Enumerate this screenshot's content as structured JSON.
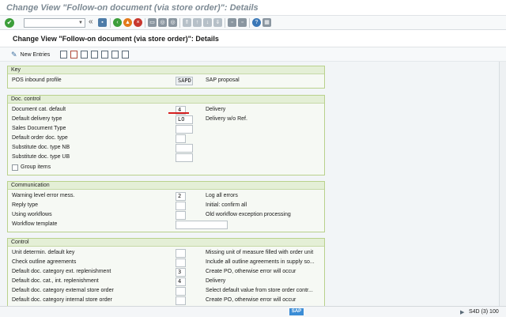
{
  "window": {
    "title": "Change View \"Follow-on document (via store order)\": Details"
  },
  "system_toolbar": {
    "ok_icon": "check-icon",
    "command_field": {
      "value": "",
      "placeholder": ""
    },
    "collapse_glyph": "«",
    "colors": {
      "green": "#3c9e3a",
      "orange": "#e37a1b",
      "red": "#c8382f",
      "blue": "#3b78b7",
      "gray": "#8a96a0"
    }
  },
  "header": {
    "title": "Change View \"Follow-on document (via store order)\": Details"
  },
  "app_toolbar": {
    "new_entries_label": "New Entries"
  },
  "groups": {
    "key": {
      "title": "Key",
      "rows": [
        {
          "label": "POS inbound profile",
          "value": "SAPD",
          "desc": "SAP proposal"
        }
      ]
    },
    "doc_control": {
      "title": "Doc. control",
      "rows": [
        {
          "label": "Document cat. default",
          "value": "4",
          "desc": "Delivery"
        },
        {
          "label": "Default delivery type",
          "value": "LO",
          "desc": "Delivery w/o Ref."
        },
        {
          "label": "Sales Document Type",
          "value": "",
          "desc": ""
        },
        {
          "label": "Default order doc. type",
          "value": "",
          "desc": ""
        },
        {
          "label": "Substitute doc. type NB",
          "value": "",
          "desc": ""
        },
        {
          "label": "Substitute doc. type UB",
          "value": "",
          "desc": ""
        }
      ],
      "checkbox": {
        "label": "Group items",
        "checked": false
      }
    },
    "communication": {
      "title": "Communication",
      "rows": [
        {
          "label": "Warning level error mess.",
          "value": "2",
          "desc": "Log all errors"
        },
        {
          "label": "Reply type",
          "value": "",
          "desc": "Initial: confirm all"
        },
        {
          "label": "Using workflows",
          "value": "",
          "desc": "Old workflow exception processing"
        },
        {
          "label": "Workflow template",
          "value": "",
          "desc": ""
        }
      ]
    },
    "control": {
      "title": "Control",
      "rows": [
        {
          "label": "Unit determin. default key",
          "value": "",
          "desc": "Missing unit of measure filled with order unit"
        },
        {
          "label": "Check outline agreements",
          "value": "",
          "desc": "Include all outline agreements in supply so..."
        },
        {
          "label": "Default doc. category ext. replenishment",
          "value": "3",
          "desc": "Create PO, otherwise error will occur"
        },
        {
          "label": "Default doc. cat., int. replenishment",
          "value": "4",
          "desc": "Delivery"
        },
        {
          "label": "Default doc. category external store order",
          "value": "",
          "desc": "Select default value from store order contr..."
        },
        {
          "label": "Default doc. category internal store order",
          "value": "",
          "desc": "Create PO, otherwise error will occur"
        }
      ]
    }
  },
  "status_bar": {
    "logo": "SAP",
    "system": "S4D (3) 100"
  }
}
